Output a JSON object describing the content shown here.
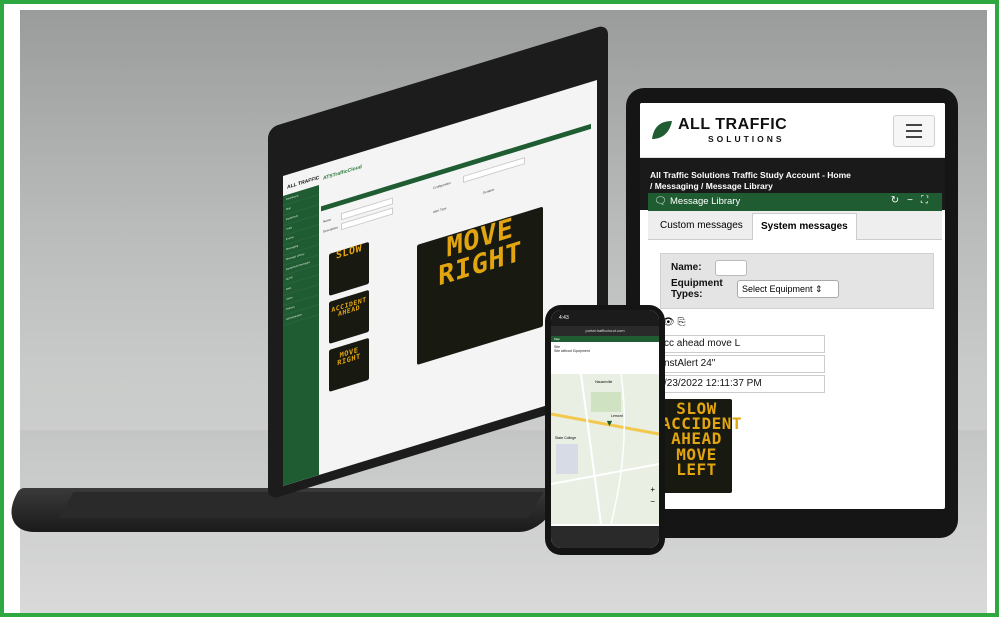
{
  "laptop": {
    "logo": "ALL TRAFFIC",
    "top_title": "ATSTrafficCloud",
    "side_items": [
      "Dashboard",
      "Map",
      "Equipment",
      "Trails",
      "Events",
      "Messaging",
      "Message Library",
      "Equipment Messages",
      "ALPR",
      "Data",
      "Users",
      "Policies",
      "Administration"
    ],
    "thumbs": [
      "SLOW",
      "ACCIDENT AHEAD",
      "MOVE RIGHT"
    ],
    "big_sign": "MOVE RIGHT",
    "field_labels": [
      "Name",
      "Description",
      "Configuration",
      "Duration",
      "Alert Type"
    ]
  },
  "tablet": {
    "brand": "ALL TRAFFIC",
    "brand_sub": "SOLUTIONS",
    "breadcrumb_line1": "All Traffic Solutions Traffic Study Account - Home",
    "breadcrumb_line2": "/ Messaging / Message Library",
    "panel_title": "Message Library",
    "tabs": [
      "Custom messages",
      "System messages"
    ],
    "name_label": "Name:",
    "equipment_label": "Equipment Types:",
    "equipment_select": "Select Equipment ⇕",
    "rows": [
      "cc ahead move L",
      "nstAlert 24\"",
      "/23/2022 12:11:37 PM"
    ],
    "sign_text": "SLOW ACCIDENT AHEAD MOVE LEFT"
  },
  "phone": {
    "time": "4:43",
    "url": "portal.trafficcloud.com",
    "header": "Map",
    "legend": [
      "Site",
      "Site without Equipment"
    ],
    "map_labels": [
      "Hauserville",
      "Lemont",
      "State College"
    ]
  },
  "colors": {
    "brand_green": "#1f5c32",
    "sign_amber": "#e2a40f",
    "frame_border": "#2fa842"
  }
}
